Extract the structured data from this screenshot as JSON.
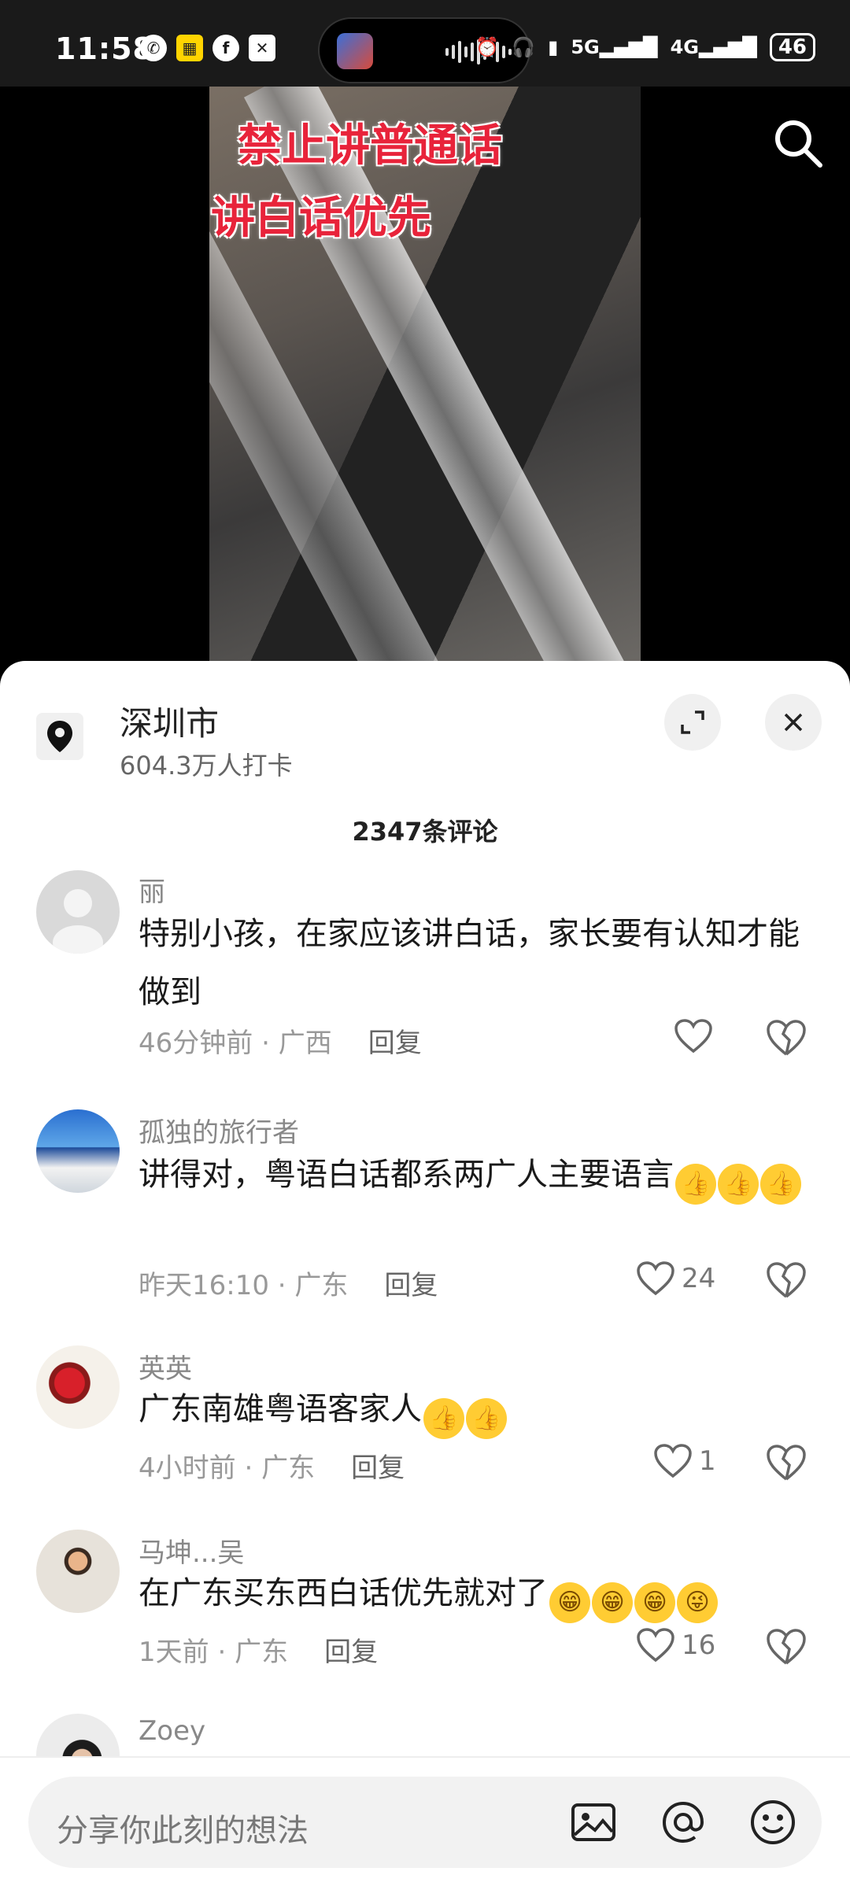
{
  "status_bar": {
    "time": "11:58",
    "left_icons": [
      "whatsapp-icon",
      "news-app-icon",
      "facebook-icon",
      "x-icon"
    ],
    "right_icons": [
      "alarm-icon",
      "headphones-icon",
      "battery-saver-icon",
      "5g-signal-icon",
      "4g-signal-icon"
    ],
    "signal1_label": "5G",
    "signal2_label": "4G",
    "battery": "46"
  },
  "video": {
    "overlay_line1": "禁止讲普通话",
    "overlay_line2": "讲白话优先"
  },
  "location": {
    "name": "深圳市",
    "checkins": "604.3万人打卡"
  },
  "comments_header": "2347条评论",
  "comments": [
    {
      "user": "丽",
      "text": "特别小孩，在家应该讲白话，家长要有认知才能做到",
      "time": "46分钟前",
      "region": "广西",
      "reply": "回复",
      "likes": ""
    },
    {
      "user": "孤独的旅行者",
      "text": "讲得对，粤语白话都系两广人主要语言",
      "time": "昨天16:10",
      "region": "广东",
      "reply": "回复",
      "likes": "24"
    },
    {
      "user": "英英",
      "text": "广东南雄粤语客家人",
      "time": "4小时前",
      "region": "广东",
      "reply": "回复",
      "likes": "1"
    },
    {
      "user": "马坤...吴",
      "text": "在广东买东西白话优先就对了",
      "time": "1天前",
      "region": "广东",
      "reply": "回复",
      "likes": "16"
    },
    {
      "user": "Zoey"
    }
  ],
  "input": {
    "placeholder": "分享你此刻的想法"
  },
  "colors": {
    "overlay_red": "#e8233a",
    "sheet_bg": "#ffffff",
    "emoji_yellow": "#ffcc33"
  }
}
